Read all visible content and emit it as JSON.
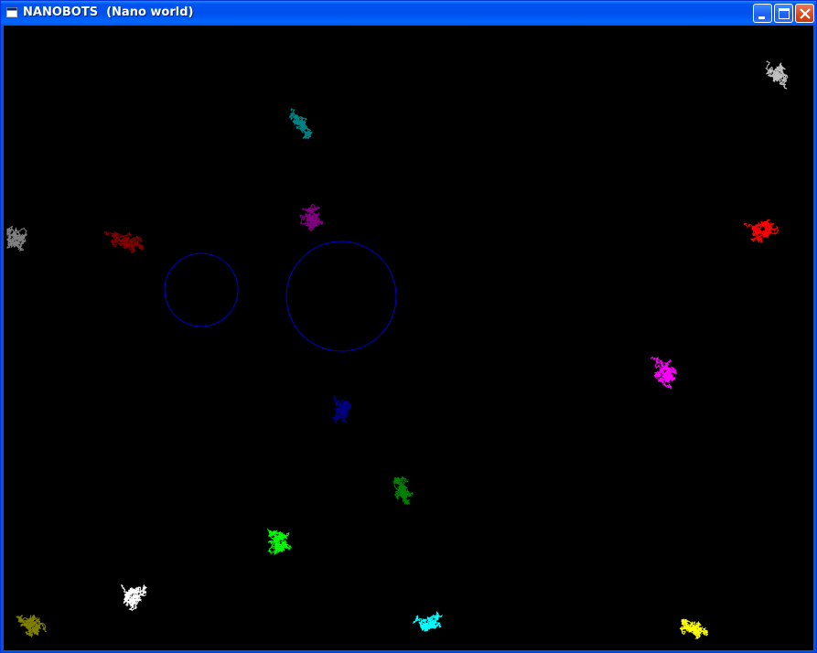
{
  "window": {
    "title": "NANOBOTS  (Nano world)",
    "icon": "app-window-icon",
    "controls": [
      "minimize-icon",
      "maximize-icon",
      "close-icon"
    ]
  },
  "canvas": {
    "background": "#000000",
    "obstacle_color": "#0000cc"
  },
  "bots": [
    {
      "color": "#c0c0c0"
    },
    {
      "color": "#008080"
    },
    {
      "color": "#800080"
    },
    {
      "color": "#800000"
    },
    {
      "color": "#808080"
    },
    {
      "color": "#ff0000"
    },
    {
      "color": "#ff00ff"
    },
    {
      "color": "#000080"
    },
    {
      "color": "#008000"
    },
    {
      "color": "#00ff00"
    },
    {
      "color": "#ffffff"
    },
    {
      "color": "#808000"
    },
    {
      "color": "#00ffff"
    },
    {
      "color": "#ffff00"
    }
  ]
}
